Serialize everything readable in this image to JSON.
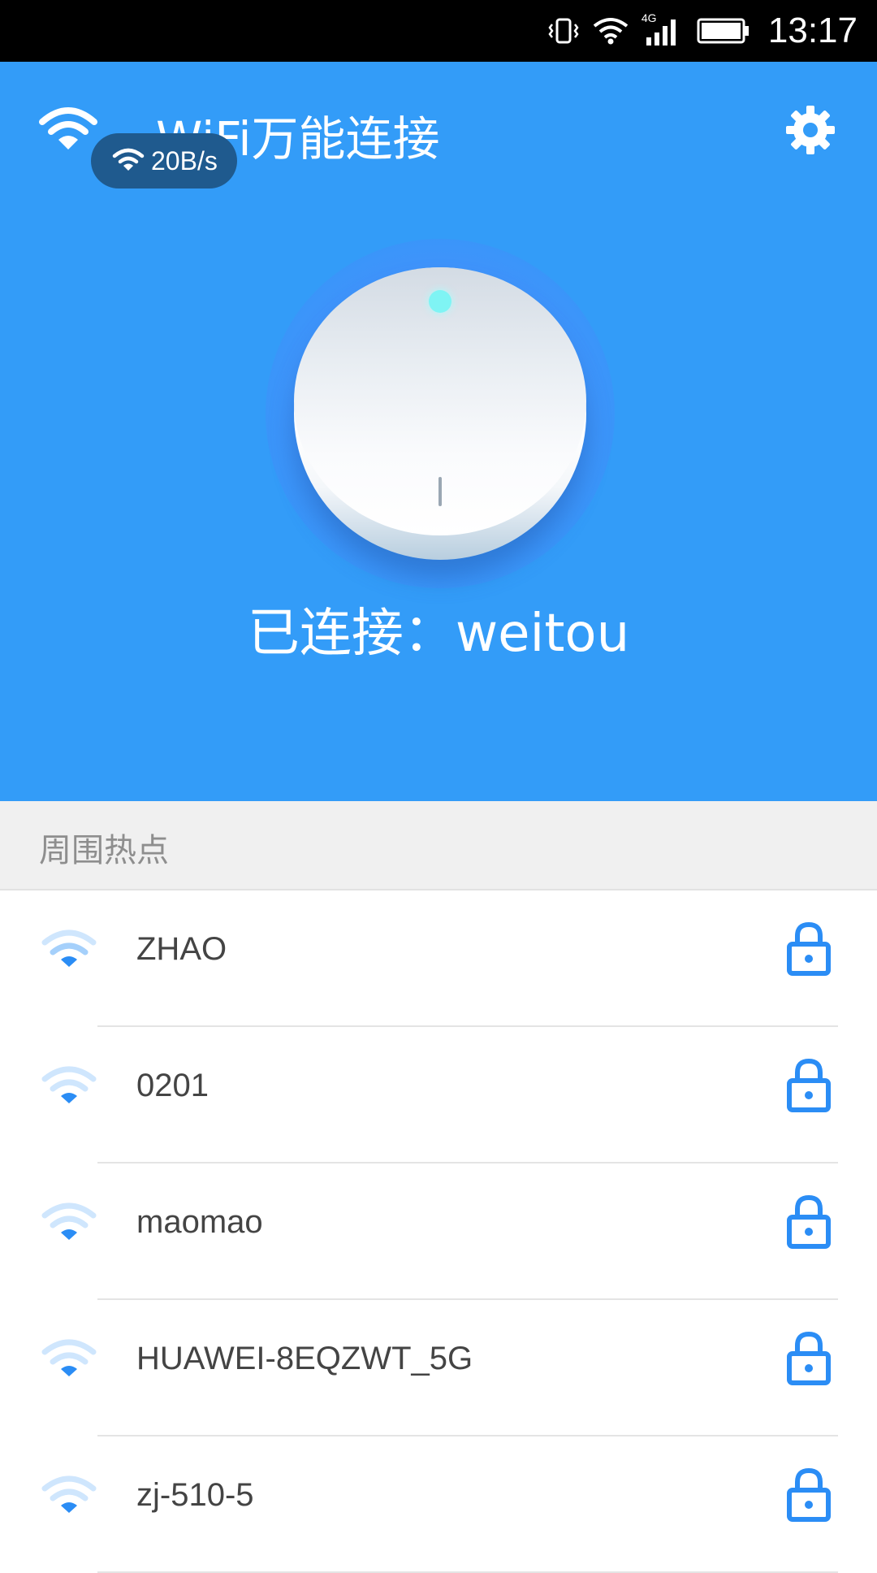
{
  "status_bar": {
    "network_type": "4G",
    "time": "13:17"
  },
  "header": {
    "app_title": "WiFi万能连接",
    "speed": "20B/s",
    "connected_label": "已连接：weitou",
    "accent_color": "#339cf8"
  },
  "hotspots": {
    "section_title": "周围热点",
    "items": [
      {
        "ssid": "ZHAO",
        "icon": "wifi-icon",
        "secured": true
      },
      {
        "ssid": "0201",
        "icon": "wifi-icon",
        "secured": true
      },
      {
        "ssid": "maomao",
        "icon": "wifi-icon",
        "secured": true
      },
      {
        "ssid": "HUAWEI-8EQZWT_5G",
        "icon": "wifi-icon",
        "secured": true
      },
      {
        "ssid": "zj-510-5",
        "icon": "wifi-icon",
        "secured": true
      }
    ]
  },
  "icons": {
    "status": [
      "vibrate-icon",
      "wifi-signal-icon",
      "cellular-signal-icon",
      "battery-icon"
    ],
    "header": [
      "wifi-icon",
      "settings-gear-icon"
    ],
    "list": [
      "wifi-icon",
      "lock-icon"
    ]
  }
}
